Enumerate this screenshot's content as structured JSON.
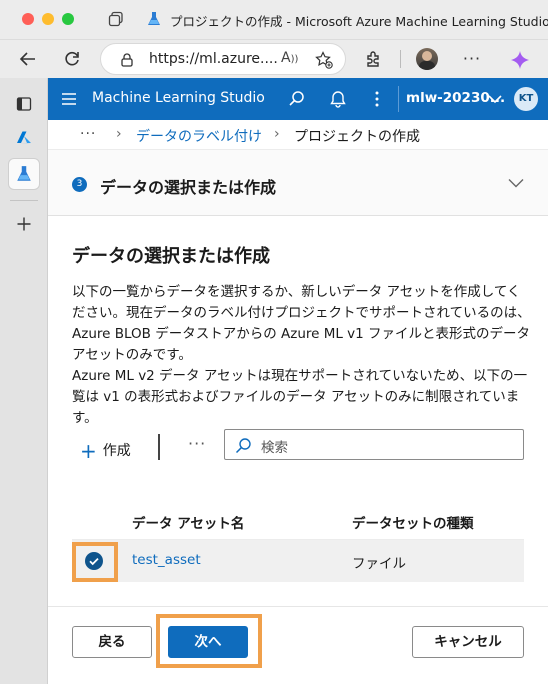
{
  "browser": {
    "window_title": "プロジェクトの作成 - Microsoft Azure Machine Learning Studio",
    "url": "https://ml.azure....",
    "traffic_light_colors": [
      "#ff5f57",
      "#febc2e",
      "#28c840"
    ]
  },
  "header": {
    "app_title": "Machine Learning Studio",
    "workspace": "mlw-20230...",
    "user_initials": "KT",
    "accent": "#0f6cbd"
  },
  "breadcrumb": {
    "more": "···",
    "items": [
      "データのラベル付け",
      "プロジェクトの作成"
    ]
  },
  "step": {
    "number": "3",
    "title": "データの選択または作成"
  },
  "main": {
    "section_title": "データの選択または作成",
    "description_1": "以下の一覧からデータを選択するか、新しいデータ アセットを作成してください。現在データのラベル付けプロジェクトでサポートされているのは、Azure BLOB データストアからの Azure ML v1 ファイルと表形式のデータ アセットのみです。",
    "description_2": "Azure ML v2 データ アセットは現在サポートされていないため、以下の一覧は v1 の表形式およびファイルのデータ アセットのみに制限されています。",
    "create_label": "作成",
    "more_label": "···",
    "search_placeholder": "検索"
  },
  "table": {
    "columns": [
      "データ アセット名",
      "データセットの種類"
    ],
    "rows": [
      {
        "name": "test_asset",
        "type": "ファイル",
        "selected": true
      }
    ]
  },
  "footer": {
    "back_label": "戻る",
    "next_label": "次へ",
    "cancel_label": "キャンセル"
  },
  "highlight_color": "#f0a04b"
}
